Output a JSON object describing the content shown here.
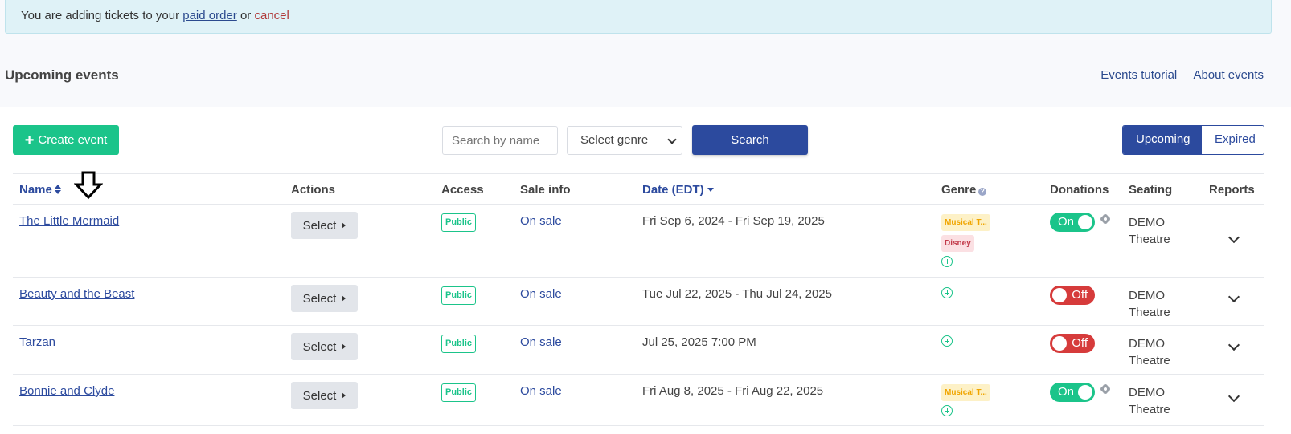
{
  "alert": {
    "prefix": "You are adding tickets to your ",
    "link": "paid order",
    "middle": " or ",
    "cancel": "cancel"
  },
  "page_title": "Upcoming events",
  "header_links": [
    "Events tutorial",
    "About events"
  ],
  "toolbar": {
    "create_label": "Create event",
    "search_placeholder": "Search by name",
    "genre_select": "Select genre",
    "search_button": "Search",
    "view_toggle": [
      "Upcoming",
      "Expired"
    ]
  },
  "columns": {
    "name": "Name",
    "actions": "Actions",
    "access": "Access",
    "sale_info": "Sale info",
    "date": "Date (EDT)",
    "genre": "Genre",
    "donations": "Donations",
    "seating": "Seating",
    "reports": "Reports"
  },
  "events": [
    {
      "name": "The Little Mermaid",
      "action": "Select",
      "access": "Public",
      "sale": "On sale",
      "date": "Fri Sep 6, 2024 - Fri Sep 19, 2025",
      "genres": [
        "Musical T...",
        "Disney"
      ],
      "donations": "On",
      "seating_line1": "DEMO",
      "seating_line2": "Theatre"
    },
    {
      "name": "Beauty and the Beast",
      "action": "Select",
      "access": "Public",
      "sale": "On sale",
      "date": "Tue Jul 22, 2025 - Thu Jul 24, 2025",
      "genres": [],
      "donations": "Off",
      "seating_line1": "DEMO",
      "seating_line2": "Theatre"
    },
    {
      "name": "Tarzan",
      "action": "Select",
      "access": "Public",
      "sale": "On sale",
      "date": "Jul 25, 2025 7:00 PM",
      "genres": [],
      "donations": "Off",
      "seating_line1": "DEMO",
      "seating_line2": "Theatre"
    },
    {
      "name": "Bonnie and Clyde",
      "action": "Select",
      "access": "Public",
      "sale": "On sale",
      "date": "Fri Aug 8, 2025 - Fri Aug 22, 2025",
      "genres": [
        "Musical T..."
      ],
      "donations": "On",
      "seating_line1": "DEMO",
      "seating_line2": "Theatre"
    }
  ],
  "colors": {
    "primary": "#2c4a9e",
    "success": "#1bc48a",
    "danger": "#d63b3b",
    "alert_bg": "#dff2f7"
  }
}
